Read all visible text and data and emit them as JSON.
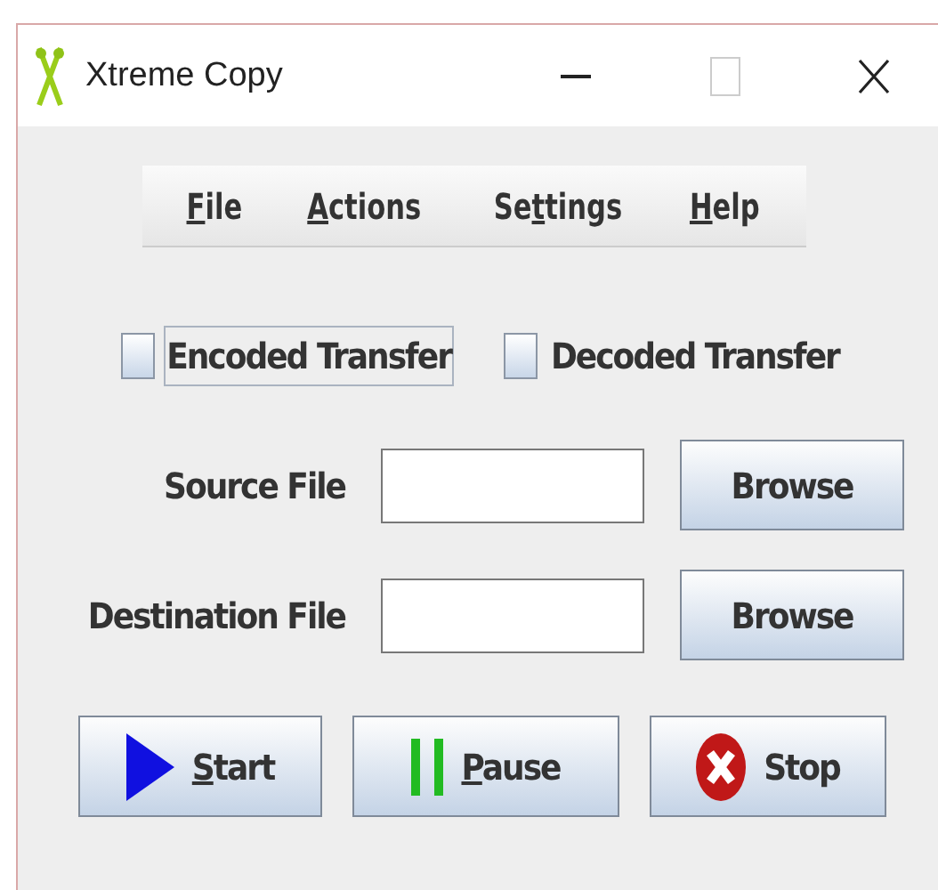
{
  "window": {
    "title": "Xtreme Copy"
  },
  "menu": [
    {
      "key": "F",
      "post": "ile"
    },
    {
      "key": "A",
      "post": "ctions"
    },
    {
      "pre": "Se",
      "key": "t",
      "post": "tings"
    },
    {
      "key": "H",
      "post": "elp"
    }
  ],
  "options": [
    {
      "label": "Encoded Transfer",
      "checked": false,
      "focused": true
    },
    {
      "label": "Decoded Transfer",
      "checked": false,
      "focused": false
    }
  ],
  "fields": [
    {
      "label": "Source File",
      "button": "Browse"
    },
    {
      "label": "Destination File",
      "button": "Browse"
    }
  ],
  "actions": [
    {
      "kind": "start",
      "key": "S",
      "post": "tart"
    },
    {
      "kind": "pause",
      "key": "P",
      "post": "ause"
    },
    {
      "kind": "stop",
      "pre": "Stop"
    }
  ]
}
